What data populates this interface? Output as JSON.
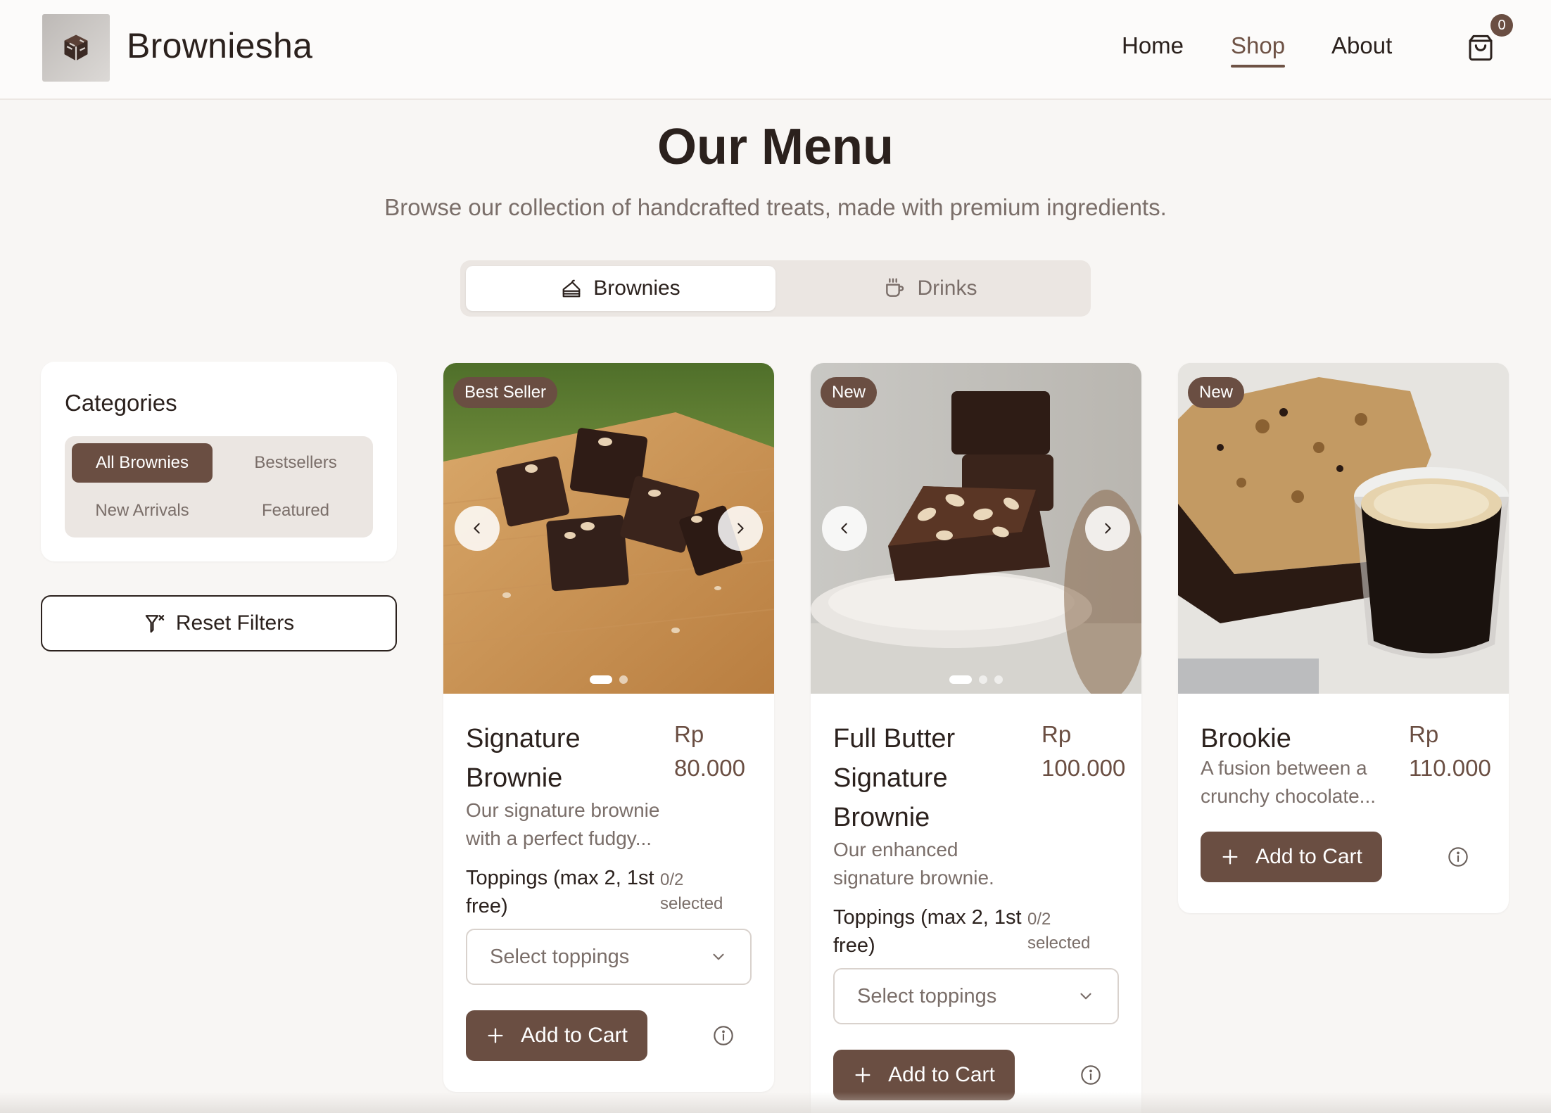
{
  "header": {
    "brand": "Browniesha",
    "nav": [
      "Home",
      "Shop",
      "About"
    ],
    "active_nav": "Shop",
    "cart_count": "0"
  },
  "hero": {
    "title": "Our Menu",
    "subtitle": "Browse our collection of handcrafted treats, made with premium ingredients."
  },
  "tabs": [
    {
      "label": "Brownies",
      "icon": "cake-icon",
      "active": true
    },
    {
      "label": "Drinks",
      "icon": "coffee-icon",
      "active": false
    }
  ],
  "sidebar": {
    "title": "Categories",
    "categories": [
      "All Brownies",
      "Bestsellers",
      "New Arrivals",
      "Featured"
    ],
    "active_category": "All Brownies",
    "reset_label": "Reset Filters"
  },
  "products": [
    {
      "badge": "Best Seller",
      "name": "Signature Brownie",
      "price_currency": "Rp",
      "price": "80.000",
      "description": "Our signature brownie with a perfect fudgy...",
      "toppings_label": "Toppings (max 2, 1st free)",
      "toppings_count": "0/2 selected",
      "toppings_placeholder": "Select toppings",
      "add_label": "Add to Cart",
      "image_count": 2
    },
    {
      "badge": "New",
      "name": "Full Butter Signature Brownie",
      "price_currency": "Rp",
      "price": "100.000",
      "description": "Our enhanced signature brownie.",
      "toppings_label": "Toppings (max 2, 1st free)",
      "toppings_count": "0/2 selected",
      "toppings_placeholder": "Select toppings",
      "add_label": "Add to Cart",
      "image_count": 3
    },
    {
      "badge": "New",
      "name": "Brookie",
      "price_currency": "Rp",
      "price": "110.000",
      "description": "A fusion between a crunchy chocolate...",
      "add_label": "Add to Cart",
      "image_count": 1
    }
  ],
  "colors": {
    "primary": "#6a4e42",
    "background": "#f8f6f4",
    "text": "#2b211d",
    "muted": "#7a6e69"
  }
}
